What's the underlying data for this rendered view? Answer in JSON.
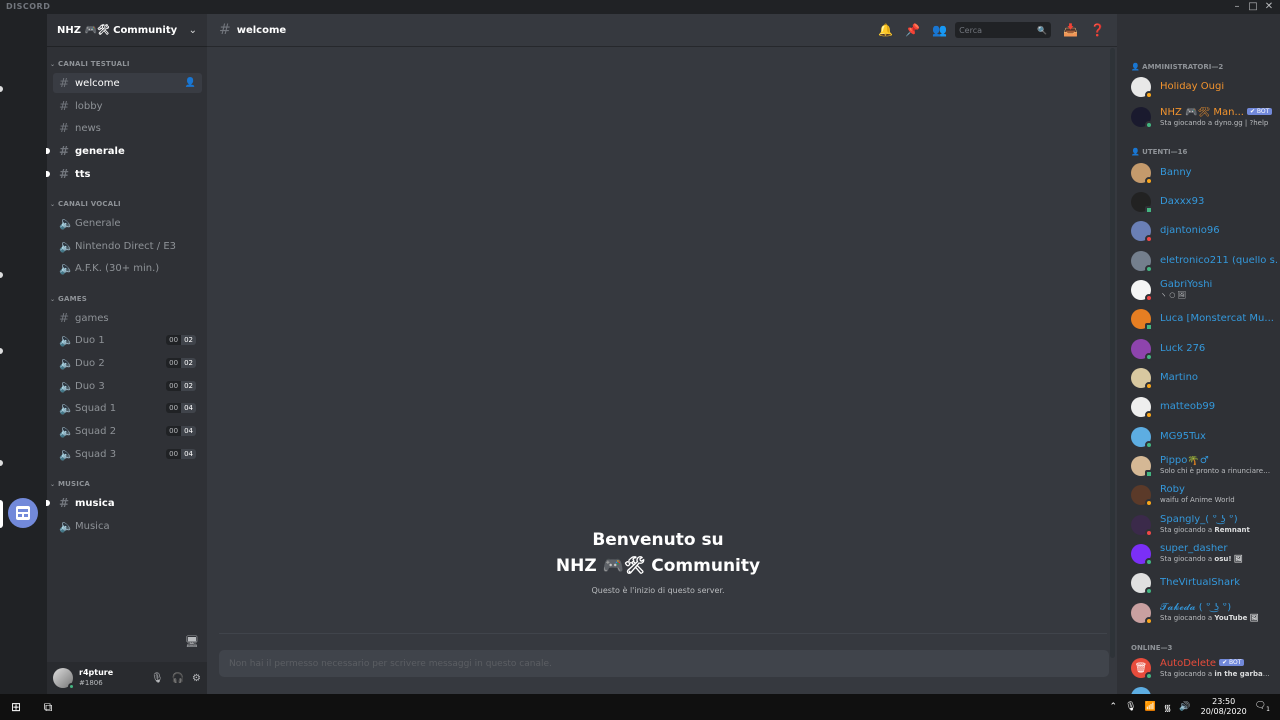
{
  "app": {
    "brand": "DISCORD"
  },
  "server": {
    "name": "NHZ 🎮🛠 Community"
  },
  "categories": {
    "text": "CANALI TESTUALI",
    "voice": "CANALI VOCALI",
    "games": "GAMES",
    "music": "MUSICA"
  },
  "channels": {
    "welcome": "welcome",
    "lobby": "lobby",
    "news": "news",
    "generale": "generale",
    "tts": "tts",
    "v_generale": "Generale",
    "nintendo": "Nintendo Direct / E3",
    "afk": "A.F.K. (30+ min.)",
    "games": "games",
    "duo1": "Duo 1",
    "duo2": "Duo 2",
    "duo3": "Duo 3",
    "squad1": "Squad 1",
    "squad2": "Squad 2",
    "squad3": "Squad 3",
    "musica_text": "musica",
    "musica_voice": "Musica"
  },
  "limits": {
    "current": "00",
    "duo": "02",
    "squad": "04"
  },
  "user": {
    "name": "r4pture",
    "tag": "#1806"
  },
  "header": {
    "channel": "welcome",
    "search_placeholder": "Cerca"
  },
  "welcome": {
    "line1": "Benvenuto su",
    "line2": "NHZ 🎮🛠 Community",
    "sub": "Questo è l'inizio di questo server."
  },
  "composer": {
    "placeholder": "Non hai il permesso necessario per scrivere messaggi in questo canale."
  },
  "member_groups": {
    "admins": "AMMINISTRATORI—2",
    "users": "UTENTI—16",
    "online": "ONLINE—3"
  },
  "members": {
    "holiday": {
      "name": "Holiday Ougi"
    },
    "nhzbot": {
      "name": "NHZ 🎮🛠 Man...",
      "tag": "✔ BOT",
      "act": "Sta giocando a dyno.gg | ?help"
    },
    "banny": {
      "name": "Banny"
    },
    "daxxx": {
      "name": "Daxxx93"
    },
    "djantonio": {
      "name": "djantonio96"
    },
    "eletronico": {
      "name": "eletronico211 (quello s..."
    },
    "gabri": {
      "name": "GabriYoshi",
      "act": "ヽ ○ 🖼"
    },
    "luca": {
      "name": "Luca [Monstercat Mu..."
    },
    "luck": {
      "name": "Luck 276"
    },
    "martino": {
      "name": "Martino"
    },
    "matteob": {
      "name": "matteob99"
    },
    "mg95": {
      "name": "MG95Tux"
    },
    "pippo": {
      "name": "Pippo🌴♂",
      "act": "Solo chi è pronto a rinunciare a..."
    },
    "roby": {
      "name": "Roby",
      "act": "waifu of Anime World"
    },
    "spangly": {
      "name": "Spangly_( ͡° ͜ʖ ͡°)",
      "act_pre": "Sta giocando a ",
      "act_b": "Remnant"
    },
    "super": {
      "name": "super_dasher",
      "act_pre": "Sta giocando a ",
      "act_b": "osu! 🖼"
    },
    "virtual": {
      "name": "TheVirtualShark"
    },
    "takeda": {
      "name": "𝓣𝓪𝓴𝓮𝓭𝓪 ( ͡° ͜ʖ ͡°)",
      "act_pre": "Sta giocando a ",
      "act_b": "YouTube 🖼"
    },
    "autodelete": {
      "name": "AutoDelete",
      "tag": "✔ BOT",
      "act_pre": "Sta giocando a ",
      "act_b": "in the garbage"
    }
  },
  "taskbar": {
    "time": "23:50",
    "date": "20/08/2020",
    "notif": "1"
  },
  "colors": {
    "accent": "#7289da",
    "online": "#43b581",
    "idle": "#faa61a",
    "dnd": "#f04747",
    "admin_name": "#f1932e",
    "user_name": "#3498db",
    "autodelete_name": "#e74c3c"
  }
}
